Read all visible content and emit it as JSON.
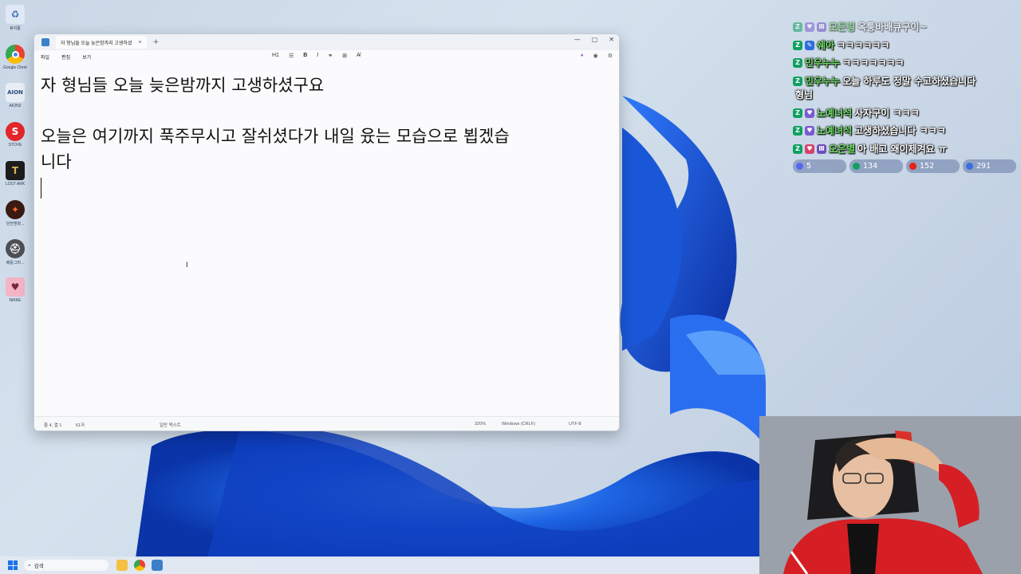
{
  "desktop": {
    "icons": [
      {
        "name": "recycle-bin-icon",
        "label": "휴지통"
      },
      {
        "name": "chrome-icon",
        "label": "Google Chrome"
      },
      {
        "name": "aion2-icon",
        "label": "AION2"
      },
      {
        "name": "stove-icon",
        "label": "STOVE"
      },
      {
        "name": "lost-ark-icon",
        "label": "LOST ARK"
      },
      {
        "name": "game-icon",
        "label": "던전앤파..."
      },
      {
        "name": "game2-icon",
        "label": "배틀그라..."
      },
      {
        "name": "nikke-icon",
        "label": "NIKKE"
      }
    ]
  },
  "notepad": {
    "tab_title": "자 형님들 오늘 늦은밤까지 고생하셨",
    "menu": [
      "파일",
      "편집",
      "보기"
    ],
    "format_tools": [
      "H1",
      "☰",
      "B",
      "I",
      "⚭",
      "⊞",
      "A̸"
    ],
    "lines": [
      "자 형님들 오늘 늦은밤까지 고생하셨구요",
      "",
      "오늘은 여기까지 푹주무시고 잘쉬셨다가 내일 윴는 모습으로 뵙겠습",
      "니다"
    ],
    "status": {
      "position": "줄 4, 열 1",
      "chars": "61자",
      "text_type": "일반 텍스트",
      "zoom": "320%",
      "line_ending": "Windows (CRLF)",
      "encoding": "UTF-8"
    }
  },
  "chat": {
    "messages": [
      {
        "nick": "모든링",
        "text": "옥퉁바배큐구이~"
      },
      {
        "nick": "쉐아",
        "text": "ㅋㅋㅋㅋㅋㅋ"
      },
      {
        "nick": "민우누누",
        "text": "ㅋㅋㅋㅋㅋㅋㅋ"
      },
      {
        "nick": "민우누누",
        "text": "오늘 하루도 정말 수고하셨습니다"
      },
      {
        "nick": "",
        "text": "형님"
      },
      {
        "nick": "노예녀석",
        "text": "사자구이 ㅋㅋㅋ"
      },
      {
        "nick": "노예녀석",
        "text": "고생하셨습니다 ㅋㅋㅋ"
      },
      {
        "nick": "오은별",
        "text": "아 배고 왜이제겨요 ㅠ"
      }
    ],
    "counts": [
      "5",
      "134",
      "152",
      "291"
    ]
  },
  "taskbar": {
    "search_placeholder": "검색"
  }
}
